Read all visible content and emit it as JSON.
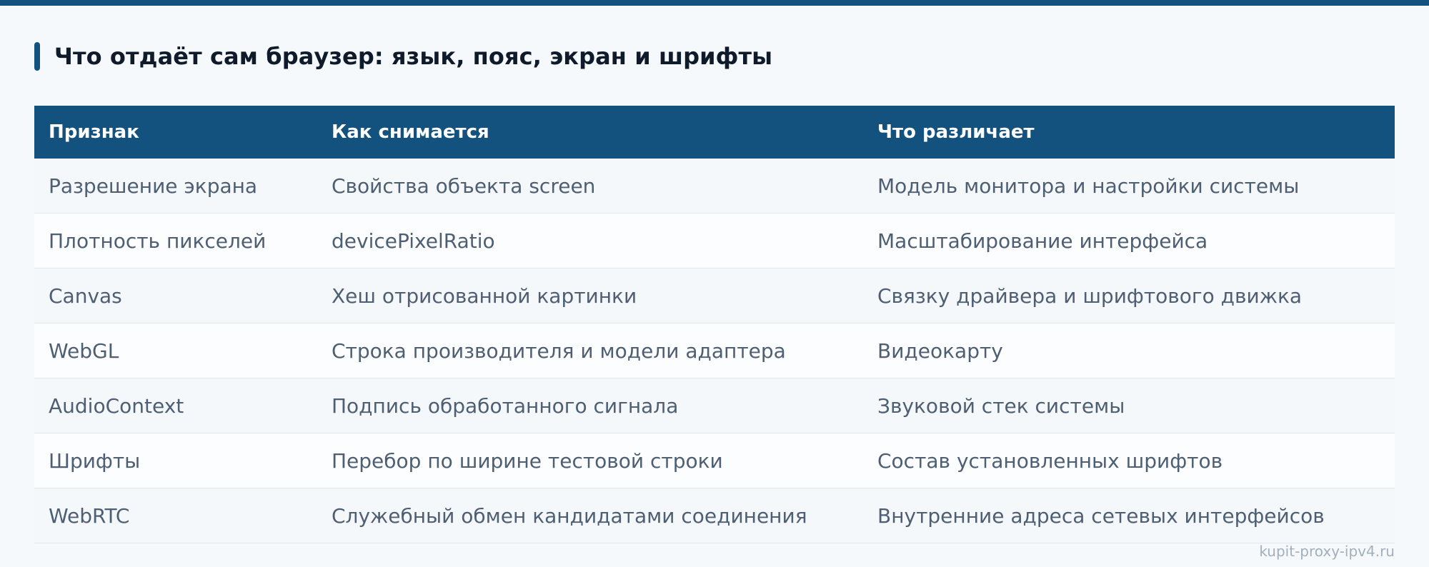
{
  "heading": {
    "title": "Что отдаёт сам браузер: язык, пояс, экран и шрифты"
  },
  "table": {
    "headers": [
      "Признак",
      "Как снимается",
      "Что различает"
    ],
    "rows": [
      [
        "Разрешение экрана",
        "Свойства объекта screen",
        "Модель монитора и настройки системы"
      ],
      [
        "Плотность пикселей",
        "devicePixelRatio",
        "Масштабирование интерфейса"
      ],
      [
        "Canvas",
        "Хеш отрисованной картинки",
        "Связку драйвера и шрифтового движка"
      ],
      [
        "WebGL",
        "Строка производителя и модели адаптера",
        "Видеокарту"
      ],
      [
        "AudioContext",
        "Подпись обработанного сигнала",
        "Звуковой стек системы"
      ],
      [
        "Шрифты",
        "Перебор по ширине тестовой строки",
        "Состав установленных шрифтов"
      ],
      [
        "WebRTC",
        "Служебный обмен кандидатами соединения",
        "Внутренние адреса сетевых интерфейсов"
      ]
    ]
  },
  "watermark": "kupit-proxy-ipv4.ru",
  "colors": {
    "accent": "#13527f",
    "background": "#f6f9fc",
    "heading_text": "#0f1b2b",
    "cell_text": "#4e5f73"
  }
}
